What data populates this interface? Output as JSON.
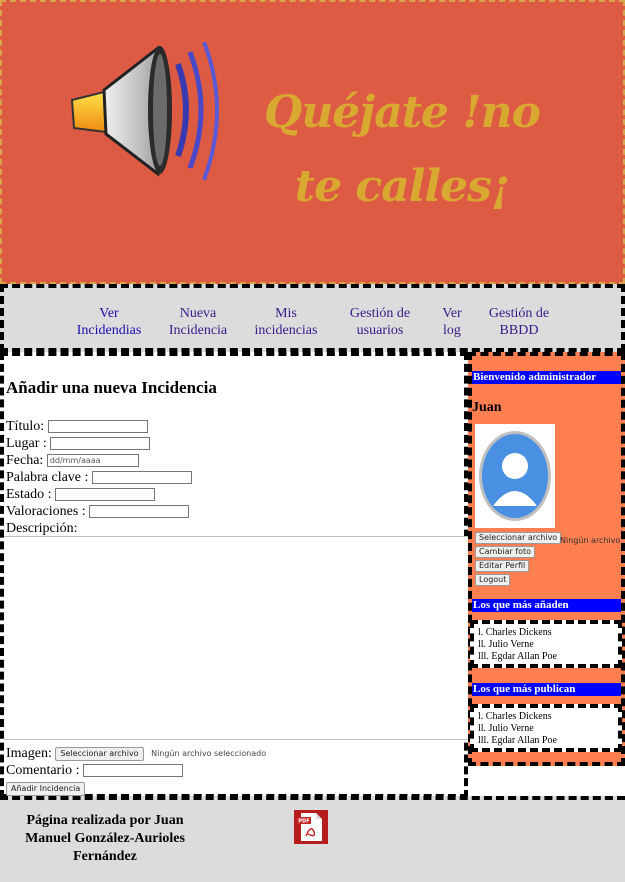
{
  "brand": {
    "title": "Quéjate !no te calles¡"
  },
  "nav": {
    "items": [
      {
        "label": "Ver Incidendias"
      },
      {
        "label": "Nueva Incidencia"
      },
      {
        "label": "Mis incidencias"
      },
      {
        "label": "Gestión de usuarios"
      },
      {
        "label": "Ver log"
      },
      {
        "label": "Gestión de BBDD"
      }
    ]
  },
  "form": {
    "title": "Añadir una nueva Incidencia",
    "titulo_label": "Título:",
    "lugar_label": "Lugar :",
    "fecha_label": "Fecha:",
    "fecha_placeholder": "dd/mm/aaaa",
    "palabra_label": "Palabra clave :",
    "estado_label": "Estado :",
    "valoraciones_label": "Valoraciones :",
    "descripcion_label": "Descripción:",
    "imagen_label": "Imagen:",
    "file_button": "Seleccionar archivo",
    "file_none": "Ningún archivo seleccionado",
    "comentario_label": "Comentario :",
    "submit": "Añadir Incidencia"
  },
  "sidebar": {
    "welcome": "Bienvenido administrador",
    "username": "Juan",
    "file_button": "Seleccionar archivo",
    "file_none": "Ningún archivo s",
    "change_photo": "Cambiar foto",
    "edit_profile": "Editar Perfil",
    "logout": "Logout",
    "top_adders_title": "Los que más añaden",
    "top_adders": [
      "l. Charles Dickens",
      "ll. Julio Verne",
      "lll. Egdar Allan Poe"
    ],
    "top_publishers_title": "Los que más publican",
    "top_publishers": [
      "l. Charles Dickens",
      "ll. Julio Verne",
      "lll. Egdar Allan Poe"
    ]
  },
  "footer": {
    "credit": "Página realizada por Juan Manuel González-Aurioles Fernández",
    "pdf_icon": "pdf-icon"
  },
  "colors": {
    "banner": "#dd5a43",
    "brand_text": "#d9a830",
    "sidebar": "#ff7f50",
    "sidebar_header": "#0000ff",
    "nav_background": "#dcdcdc"
  }
}
